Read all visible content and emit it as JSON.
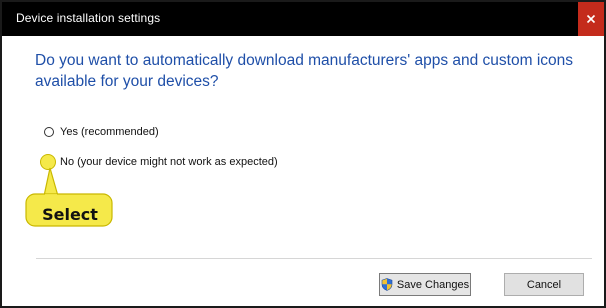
{
  "window": {
    "title": "Device installation settings",
    "close_label": "×"
  },
  "question": "Do you want to automatically download manufacturers' apps and custom icons available for your devices?",
  "options": [
    {
      "label": "Yes (recommended)",
      "checked": false
    },
    {
      "label": "No (your device might not work as expected)",
      "checked": true
    }
  ],
  "callout": {
    "text": "Select",
    "color": "#f5e94a"
  },
  "buttons": {
    "save_label": "Save Changes",
    "save_icon": "uac-shield-icon",
    "cancel_label": "Cancel"
  },
  "colors": {
    "title_bar": "#000000",
    "close_button": "#c42b1c",
    "question_text": "#1f4fa8"
  }
}
